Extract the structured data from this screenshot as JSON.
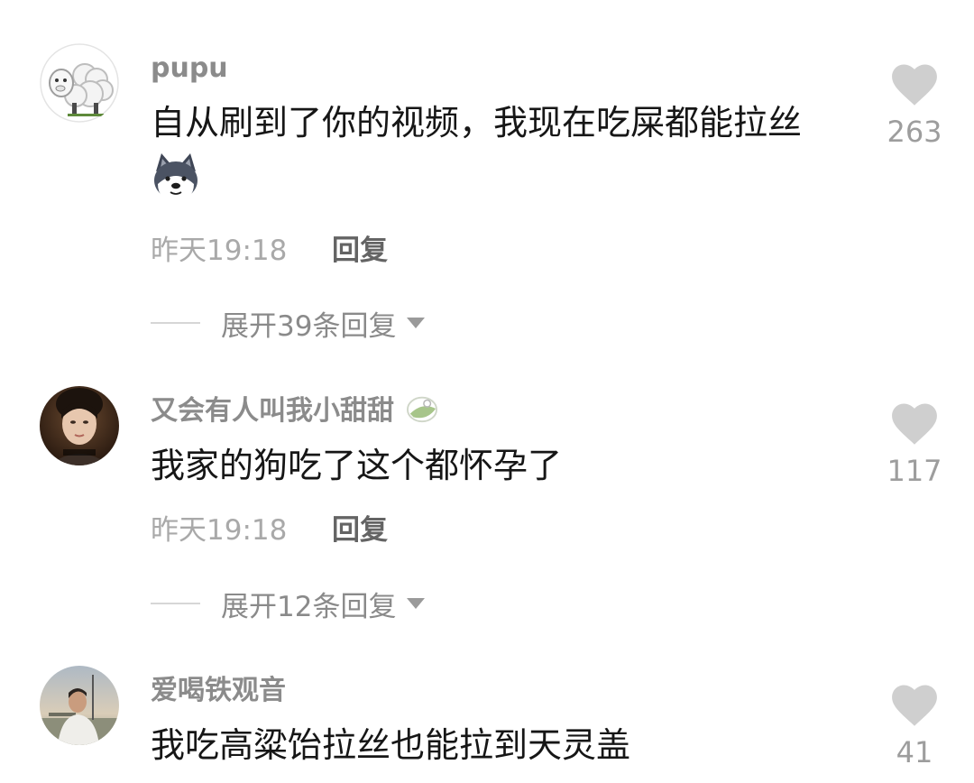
{
  "comments": [
    {
      "username": "pupu",
      "text": "自从刷到了你的视频，我现在吃屎都能拉丝",
      "sticker": "husky-face-icon",
      "time": "昨天19:18",
      "reply_label": "回复",
      "expand_label": "展开39条回复",
      "likes": "263"
    },
    {
      "username": "又会有人叫我小甜甜",
      "badge": "leaf-badge-icon",
      "text": "我家的狗吃了这个都怀孕了",
      "time": "昨天19:18",
      "reply_label": "回复",
      "expand_label": "展开12条回复",
      "likes": "117"
    },
    {
      "username": "爱喝铁观音",
      "text": "我吃高粱饴拉丝也能拉到天灵盖",
      "likes": "41"
    }
  ],
  "icons": {
    "like": "heart-icon",
    "expand": "caret-down-icon"
  },
  "colors": {
    "username": "#8b8b8b",
    "text": "#161616",
    "meta": "#a9a9a9",
    "reply": "#646464",
    "heart": "#cfcfcf"
  }
}
